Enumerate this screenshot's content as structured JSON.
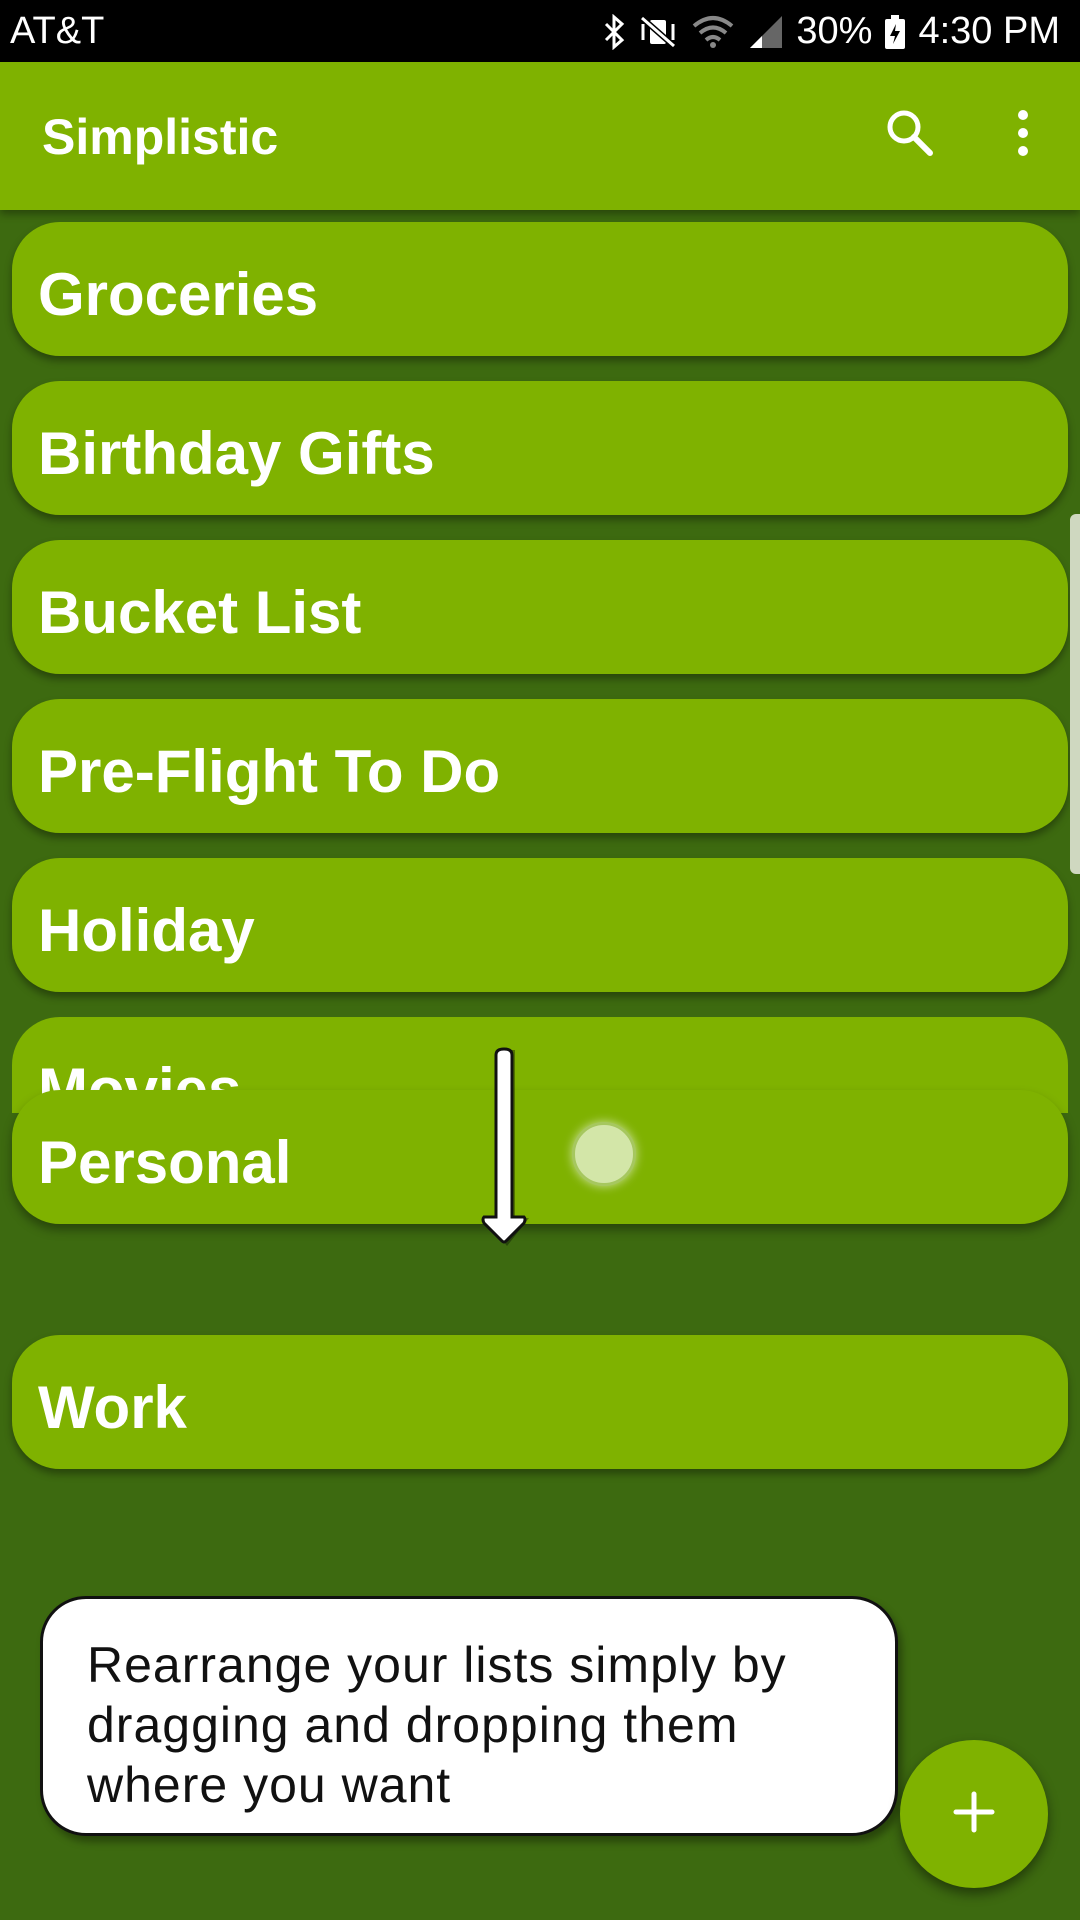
{
  "status_bar": {
    "carrier": "AT&T",
    "battery": "30%",
    "time": "4:30 PM",
    "icons": [
      "bluetooth-icon",
      "vibrate-mute-icon",
      "wifi-icon",
      "signal-icon",
      "battery-charging-icon"
    ]
  },
  "app_bar": {
    "title": "Simplistic",
    "actions": [
      "search-icon",
      "more-vert-icon"
    ]
  },
  "lists": [
    {
      "label": "Groceries"
    },
    {
      "label": "Birthday Gifts"
    },
    {
      "label": "Bucket List"
    },
    {
      "label": "Pre-Flight To Do"
    },
    {
      "label": "Holiday"
    },
    {
      "label": "Movies"
    },
    {
      "label": "Personal"
    },
    {
      "label": "Work"
    }
  ],
  "tip": {
    "text": "Rearrange your lists simply by dragging and dropping them where you want"
  },
  "fab": {
    "icon": "plus-icon"
  },
  "colors": {
    "primary": "#7fb200",
    "background": "#3d6a10",
    "text": "#ffffff"
  }
}
